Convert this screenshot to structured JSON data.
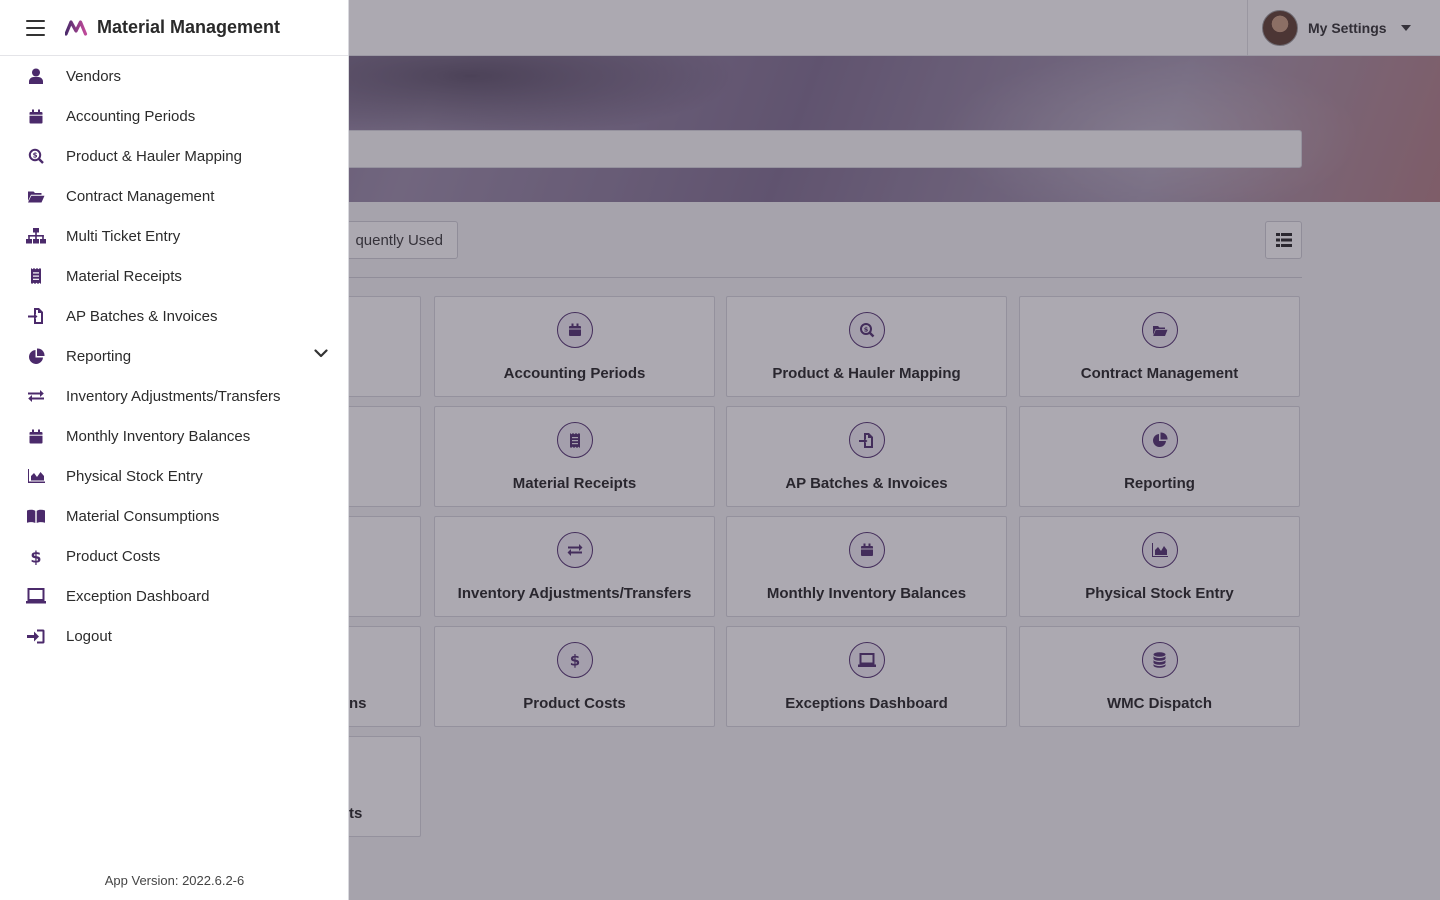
{
  "app": {
    "title": "Material Management",
    "version": "App Version: 2022.6.2-6"
  },
  "header": {
    "settings_label": "My Settings"
  },
  "tabs": {
    "frequently_used_visible": "quently Used"
  },
  "tiles": [
    {
      "label": "Accounting Periods",
      "icon": "calendar-icon"
    },
    {
      "label": "Product & Hauler Mapping",
      "icon": "search-dollar-icon"
    },
    {
      "label": "Contract Management",
      "icon": "folder-open-icon"
    },
    {
      "label": "Material Receipts",
      "icon": "receipt-icon"
    },
    {
      "label": "AP Batches & Invoices",
      "icon": "file-import-icon"
    },
    {
      "label": "Reporting",
      "icon": "pie-chart-icon"
    },
    {
      "label": "Inventory Adjustments/Transfers",
      "icon": "exchange-icon"
    },
    {
      "label": "Monthly Inventory Balances",
      "icon": "calendar-icon"
    },
    {
      "label": "Physical Stock Entry",
      "icon": "area-chart-icon"
    },
    {
      "label": "Product Costs",
      "icon": "dollar-icon"
    },
    {
      "label": "Exceptions Dashboard",
      "icon": "laptop-icon"
    },
    {
      "label": "WMC Dispatch",
      "icon": "database-icon"
    }
  ],
  "cut_tiles": [
    {
      "label": "ns"
    },
    {
      "label": "ts"
    }
  ],
  "sidebar": {
    "items": [
      {
        "label": "Vendors",
        "icon": "user-icon"
      },
      {
        "label": "Accounting Periods",
        "icon": "calendar-icon"
      },
      {
        "label": "Product & Hauler Mapping",
        "icon": "search-dollar-icon"
      },
      {
        "label": "Contract Management",
        "icon": "folder-open-icon"
      },
      {
        "label": "Multi Ticket Entry",
        "icon": "sitemap-icon"
      },
      {
        "label": "Material Receipts",
        "icon": "receipt-icon"
      },
      {
        "label": "AP Batches & Invoices",
        "icon": "file-import-icon"
      },
      {
        "label": "Reporting",
        "icon": "pie-chart-icon",
        "expandable": true
      },
      {
        "label": "Inventory Adjustments/Transfers",
        "icon": "exchange-icon"
      },
      {
        "label": "Monthly Inventory Balances",
        "icon": "calendar-icon"
      },
      {
        "label": "Physical Stock Entry",
        "icon": "area-chart-icon"
      },
      {
        "label": "Material Consumptions",
        "icon": "book-icon"
      },
      {
        "label": "Product Costs",
        "icon": "dollar-icon"
      },
      {
        "label": "Exception Dashboard",
        "icon": "laptop-icon"
      },
      {
        "label": "Logout",
        "icon": "sign-in-icon"
      }
    ]
  },
  "colors": {
    "accent": "#4b2a6b",
    "logo_gradient_start": "#4b2a6b",
    "logo_gradient_end": "#c04a9a"
  }
}
